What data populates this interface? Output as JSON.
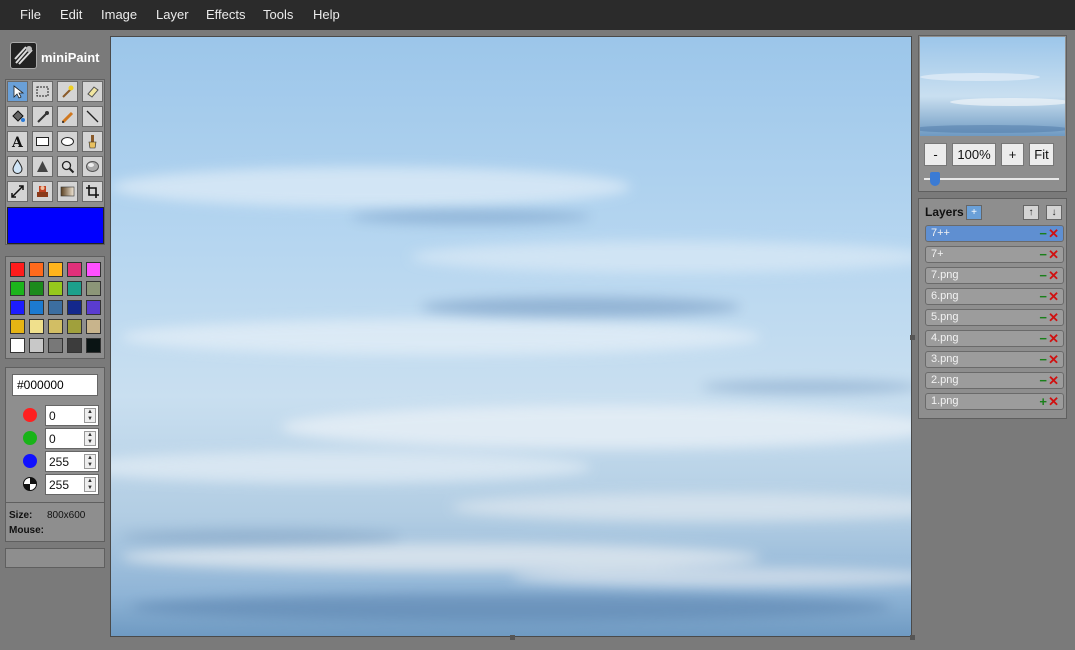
{
  "menu": [
    "File",
    "Edit",
    "Image",
    "Layer",
    "Effects",
    "Tools",
    "Help"
  ],
  "app": {
    "name": "miniPaint"
  },
  "tools": [
    {
      "name": "select-tool-icon",
      "active": true
    },
    {
      "name": "rect-select-tool-icon"
    },
    {
      "name": "magic-wand-tool-icon"
    },
    {
      "name": "eraser-tool-icon"
    },
    {
      "name": "fill-tool-icon"
    },
    {
      "name": "color-picker-tool-icon"
    },
    {
      "name": "pencil-tool-icon"
    },
    {
      "name": "line-tool-icon"
    },
    {
      "name": "text-tool-icon"
    },
    {
      "name": "rectangle-tool-icon"
    },
    {
      "name": "ellipse-tool-icon"
    },
    {
      "name": "brush-tool-icon"
    },
    {
      "name": "blur-tool-icon"
    },
    {
      "name": "sharpen-tool-icon"
    },
    {
      "name": "zoom-tool-icon"
    },
    {
      "name": "bulge-tool-icon"
    },
    {
      "name": "resize-tool-icon"
    },
    {
      "name": "clone-tool-icon"
    },
    {
      "name": "gradient-tool-icon"
    },
    {
      "name": "crop-tool-icon"
    }
  ],
  "active_color": "#0000ff",
  "palette": [
    "#ff1c1c",
    "#ff6a1c",
    "#ffb41c",
    "#e0307a",
    "#ff50ff",
    "#1cb41c",
    "#1c8a1c",
    "#96c81c",
    "#1ca08c",
    "#8c9678",
    "#1c1cff",
    "#1c7ad0",
    "#3c6ea0",
    "#14288c",
    "#5a3cd0",
    "#e6b414",
    "#f0e08c",
    "#d2be64",
    "#a0a03c",
    "#c8b48c",
    "#ffffff",
    "#c8c8c8",
    "#787878",
    "#3c3c3c",
    "#0a1414"
  ],
  "color_panel": {
    "hex": "#000000",
    "channels": [
      {
        "name": "red",
        "color": "#ff2020",
        "value": "0"
      },
      {
        "name": "green",
        "color": "#18b418",
        "value": "0"
      },
      {
        "name": "blue",
        "color": "#1010ff",
        "value": "255"
      },
      {
        "name": "alpha",
        "color": "#ffffff",
        "value": "255"
      }
    ]
  },
  "info": {
    "size_label": "Size:",
    "size_value": "800x600",
    "mouse_label": "Mouse:",
    "mouse_value": ""
  },
  "zoom": {
    "minus": "-",
    "value": "100%",
    "plus": "+",
    "fit": "Fit",
    "slider_level": 0.08
  },
  "layers": {
    "title": "Layers",
    "items": [
      {
        "name": "7++",
        "active": true,
        "visible": true
      },
      {
        "name": "7+",
        "visible": true
      },
      {
        "name": "7.png",
        "visible": true
      },
      {
        "name": "6.png",
        "visible": true
      },
      {
        "name": "5.png",
        "visible": true
      },
      {
        "name": "4.png",
        "visible": true
      },
      {
        "name": "3.png",
        "visible": true
      },
      {
        "name": "2.png",
        "visible": true
      },
      {
        "name": "1.png",
        "visible": false
      }
    ]
  }
}
